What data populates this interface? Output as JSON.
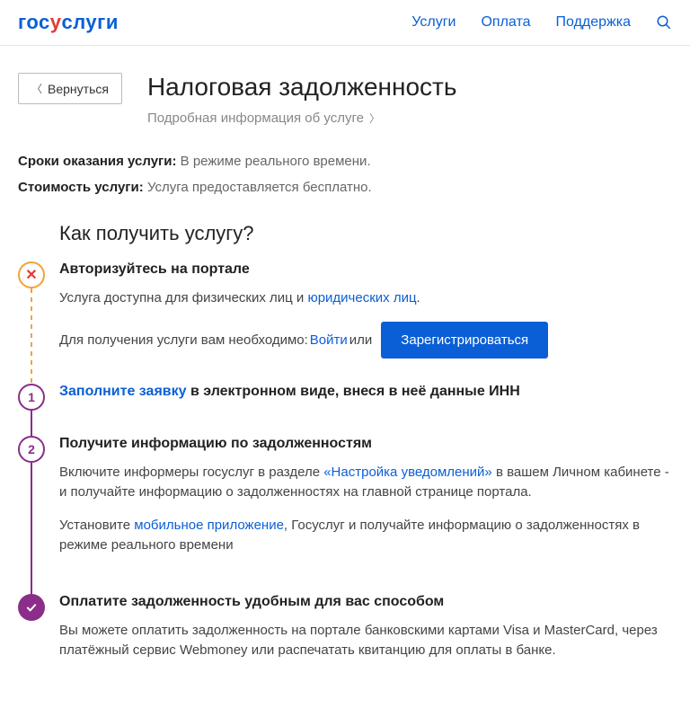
{
  "header": {
    "logo_parts": {
      "a": "гос",
      "b": "у",
      "c": "слуги"
    },
    "nav": {
      "services": "Услуги",
      "payment": "Оплата",
      "support": "Поддержка"
    }
  },
  "back_label": "Вернуться",
  "page_title": "Налоговая задолженность",
  "detail_link": "Подробная информация об услуге",
  "meta": {
    "time_label": "Сроки оказания услуги:",
    "time_value": "В режиме реального времени.",
    "cost_label": "Стоимость услуги:",
    "cost_value": "Услуга предоставляется бесплатно."
  },
  "steps_title": "Как получить услугу?",
  "step0": {
    "title": "Авторизуйтесь на портале",
    "p1_a": "Услуга доступна для физических лиц и ",
    "p1_link": "юридических лиц",
    "login_text_a": "Для получения услуги вам необходимо: ",
    "login_link": "Войти",
    "login_text_b": " или",
    "register_btn": "Зарегистрироваться"
  },
  "step1": {
    "num": "1",
    "title_link": "Заполните заявку",
    "title_rest": " в электронном виде, внеся в неё данные ИНН"
  },
  "step2": {
    "num": "2",
    "title": "Получите информацию по задолженностям",
    "p1_a": "Включите информеры госуслуг в разделе ",
    "p1_link": "«Настройка уведомлений»",
    "p1_b": " в вашем Личном кабинете - и получайте информацию о задолженностях на главной странице портала.",
    "p2_a": "Установите ",
    "p2_link": "мобильное приложение",
    "p2_b": ", Госуслуг и получайте информацию о задолженностях в режиме реального времени"
  },
  "step3": {
    "title": "Оплатите задолженность удобным для вас способом",
    "p": "Вы можете оплатить задолженность на портале банковскими картами Visa и MasterCard, через платёжный сервис Webmoney или распечатать квитанцию для оплаты в банке."
  }
}
